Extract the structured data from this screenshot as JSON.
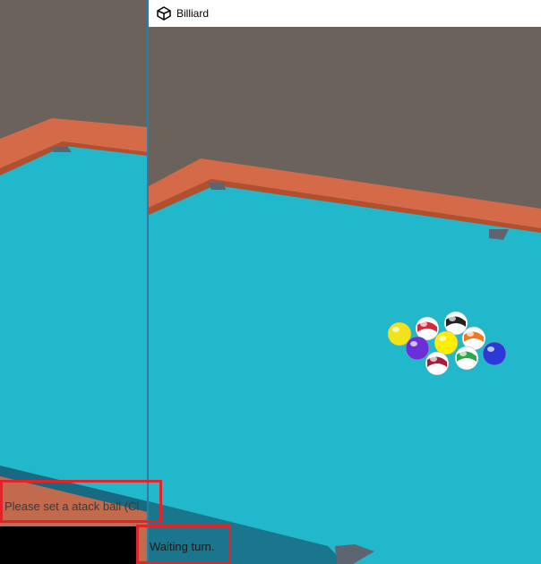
{
  "window": {
    "title": "Billiard",
    "icon": "unity-logo-icon"
  },
  "left_view": {
    "status_text": "Please set a atack ball (Cl"
  },
  "right_view": {
    "status_text": "Waiting turn."
  },
  "colors": {
    "cloth": "#22b8cc",
    "rail": "#d56a48",
    "wall": "#6b625c",
    "highlight_box": "#e0242a"
  },
  "balls": [
    {
      "name": "yellow-ball",
      "color": "#f2e21a",
      "striped": false
    },
    {
      "name": "red-striped-ball",
      "color": "#d8283a",
      "striped": true
    },
    {
      "name": "black-striped-ball",
      "color": "#222222",
      "striped": true
    },
    {
      "name": "purple-ball",
      "color": "#6a2fd8",
      "striped": false
    },
    {
      "name": "yellow-center-ball",
      "color": "#ffee00",
      "striped": false
    },
    {
      "name": "orange-striped-ball",
      "color": "#f0781e",
      "striped": true
    },
    {
      "name": "dark-red-striped-ball",
      "color": "#a0203a",
      "striped": true
    },
    {
      "name": "green-striped-ball",
      "color": "#2aa84a",
      "striped": true
    },
    {
      "name": "blue-ball",
      "color": "#2a3ad8",
      "striped": false
    }
  ]
}
